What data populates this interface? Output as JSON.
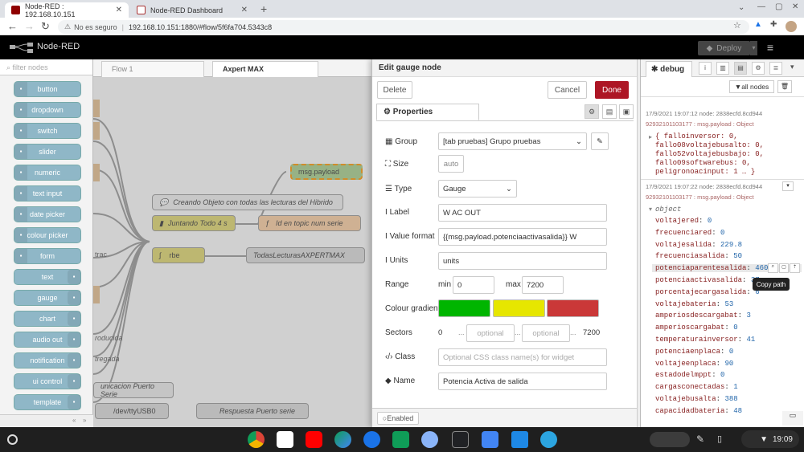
{
  "browser": {
    "tabs": [
      {
        "title": "Node-RED : 192.168.10.151",
        "active": true
      },
      {
        "title": "Node-RED Dashboard",
        "active": false
      }
    ],
    "new_tab": "+",
    "security": "No es seguro",
    "url": "192.168.10.151:1880/#flow/5f6fa704.5343c8"
  },
  "app": {
    "title": "Node-RED",
    "deploy_label": "Deploy",
    "menu_icon": "hamburger-icon"
  },
  "palette": {
    "filter_placeholder": "filter nodes",
    "nodes": [
      "button",
      "dropdown",
      "switch",
      "slider",
      "numeric",
      "text input",
      "date picker",
      "colour picker",
      "form",
      "text",
      "gauge",
      "chart",
      "audio out",
      "notification",
      "ui control",
      "template"
    ]
  },
  "workspace": {
    "tabs": [
      "Flow 1",
      "Axpert MAX"
    ],
    "active_tab": "Axpert MAX",
    "flow_nodes": [
      "msg.payload",
      "Creando Objeto con todas las lecturas del Hibrido",
      "Juntando Todo 4 s",
      "Id en topic num serie",
      "rbe",
      "TodasLecturasAXPERTMAX",
      "trac",
      "roducida",
      "tregada",
      "unicacion Puerto Serie",
      "/dev/ttyUSB0",
      "Respuesta Puerto serie"
    ]
  },
  "editor": {
    "title": "Edit gauge node",
    "delete_label": "Delete",
    "cancel_label": "Cancel",
    "done_label": "Done",
    "properties_tab": "Properties",
    "labels": {
      "group": "Group",
      "size": "Size",
      "type": "Type",
      "label": "Label",
      "value_format": "Value format",
      "units": "Units",
      "range": "Range",
      "colour_gradient": "Colour gradient",
      "sectors": "Sectors",
      "class": "Class",
      "name": "Name"
    },
    "values": {
      "group": "[tab pruebas] Grupo pruebas",
      "size": "auto",
      "type": "Gauge",
      "label": "W AC OUT",
      "value_format": "{{msg.payload.potenciaactivasalida}} W",
      "units": "units",
      "range_min_label": "min",
      "range_min": "0",
      "range_max_label": "max",
      "range_max": "7200",
      "sector_start": "0",
      "sector_end": "7200",
      "sector_placeholder": "optional",
      "class_placeholder": "Optional CSS class name(s) for widget",
      "name": "Potencia Activa de salida"
    },
    "colours": [
      "#00b500",
      "#e6e600",
      "#ca3838"
    ],
    "enabled_label": "Enabled"
  },
  "sidebar": {
    "tab": "debug",
    "filter_label": "all nodes",
    "messages": [
      {
        "meta": "17/9/2021 19:07:12   node: 2838ecfd.8cd944",
        "topic": "92932101103177 : msg.payload : Object"
      },
      {
        "meta": "17/9/2021 19:07:22   node: 2838ecfd.8cd944",
        "topic": "92932101103177 : msg.payload : Object"
      }
    ],
    "collapsed_object": [
      "{ falloinversor: 0,",
      "fallo08voltajebusalto: 0,",
      "fallo52voltajebusbajo: 0,",
      "fallo09softwarebus: 0,",
      "peligronoacinput: 1 … }"
    ],
    "object_label": "object",
    "properties": [
      {
        "k": "voltajered",
        "v": "0"
      },
      {
        "k": "frecuenciared",
        "v": "0"
      },
      {
        "k": "voltajesalida",
        "v": "229.8"
      },
      {
        "k": "frecuenciasalida",
        "v": "50"
      },
      {
        "k": "potenciaparentesalida",
        "v": "460"
      },
      {
        "k": "potenciaactivasalida",
        "v": "37"
      },
      {
        "k": "porcentajecargasalida",
        "v": "6"
      },
      {
        "k": "voltajebateria",
        "v": "53"
      },
      {
        "k": "amperiosdescargabat",
        "v": "3"
      },
      {
        "k": "amperioscargabat",
        "v": "0"
      },
      {
        "k": "temperaturainversor",
        "v": "41"
      },
      {
        "k": "potenciaenplaca",
        "v": "0"
      },
      {
        "k": "voltajeenplaca",
        "v": "90"
      },
      {
        "k": "estadodelmppt",
        "v": "0"
      },
      {
        "k": "cargasconectadas",
        "v": "1"
      },
      {
        "k": "voltajebusalta",
        "v": "388"
      },
      {
        "k": "capacidadbateria",
        "v": "48"
      }
    ],
    "tooltip": "Copy path"
  },
  "taskbar": {
    "time": "19:09",
    "apps": [
      "chrome-icon",
      "gmail-icon",
      "youtube-icon",
      "play-store-icon",
      "files-icon",
      "sheets-icon",
      "weather-icon",
      "terminal-icon",
      "folder-icon",
      "vm-icon",
      "telegram-icon"
    ]
  }
}
